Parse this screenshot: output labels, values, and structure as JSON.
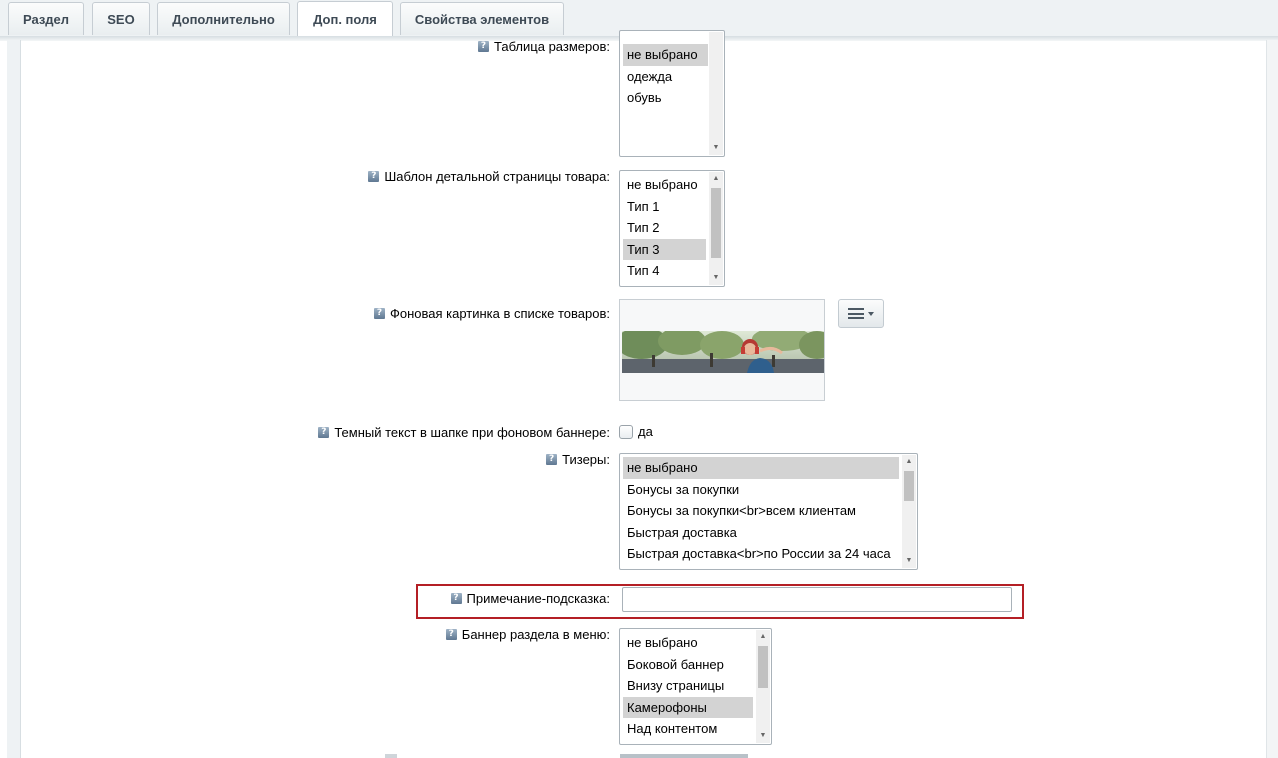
{
  "tabs": [
    {
      "label": "Раздел",
      "active": false
    },
    {
      "label": "SEO",
      "active": false
    },
    {
      "label": "Дополнительно",
      "active": false
    },
    {
      "label": "Доп. поля",
      "active": true
    },
    {
      "label": "Свойства элементов",
      "active": false
    }
  ],
  "fields": {
    "size_table": {
      "label": "Таблица размеров:",
      "options": [
        "не выбрано",
        "одежда",
        "обувь"
      ],
      "selected": "не выбрано"
    },
    "detail_template": {
      "label": "Шаблон детальной страницы товара:",
      "options": [
        "не выбрано",
        "Тип 1",
        "Тип 2",
        "Тип 3",
        "Тип 4"
      ],
      "selected": "Тип 3"
    },
    "background_image": {
      "label": "Фоновая картинка в списке товаров:",
      "menu_icon": "hamburger-menu-icon"
    },
    "dark_text": {
      "label": "Темный текст в шапке при фоновом баннере:",
      "checkbox_label": "да",
      "checked": false
    },
    "teasers": {
      "label": "Тизеры:",
      "options": [
        "не выбрано",
        "Бонусы за покупки",
        "Бонусы за покупки<br>всем клиентам",
        "Быстрая доставка",
        "Быстрая доставка<br>по России за 24 часа"
      ],
      "selected": "не выбрано"
    },
    "hint_note": {
      "label": "Примечание-подсказка:",
      "value": "",
      "highlight_color": "#b41f25"
    },
    "menu_banner": {
      "label": "Баннер раздела в меню:",
      "options": [
        "не выбрано",
        "Боковой баннер",
        "Внизу страницы",
        "Камерофоны",
        "Над контентом"
      ],
      "selected": "Камерофоны"
    }
  },
  "help_icon": "question-icon",
  "help_glyph": "?"
}
